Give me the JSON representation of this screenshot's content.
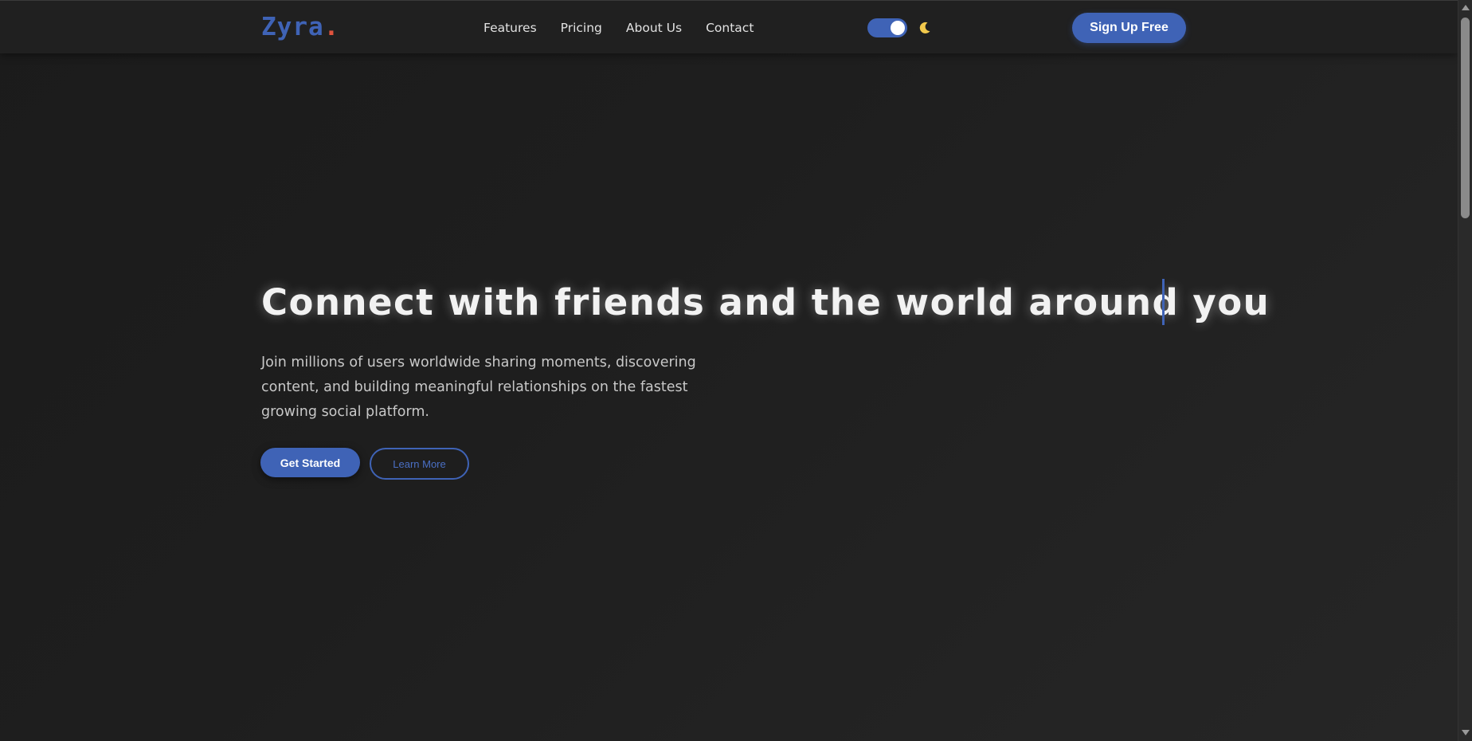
{
  "navbar": {
    "logo_text": "Zyra",
    "logo_dot": ".",
    "links": [
      "Features",
      "Pricing",
      "About Us",
      "Contact"
    ],
    "theme_toggle_state": "on",
    "moon_icon": "moon-icon",
    "signup_label": "Sign Up Free"
  },
  "hero": {
    "title": "Connect with friends and the world around you",
    "subtitle": "Join millions of users worldwide sharing moments, discovering content, and building meaningful relationships on the fastest growing social platform.",
    "primary_label": "Get Started",
    "secondary_label": "Learn More"
  },
  "colors": {
    "accent": "#3f63b6",
    "logo_dot": "#e0533d",
    "background": "#1e1e1e",
    "moon": "#f2c94c"
  }
}
